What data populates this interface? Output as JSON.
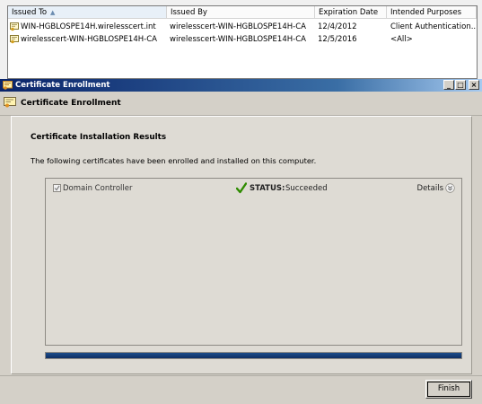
{
  "cert_list": {
    "columns": [
      "Issued To",
      "Issued By",
      "Expiration Date",
      "Intended Purposes"
    ],
    "sorted_column": "Issued To",
    "rows": [
      {
        "issued_to": "WIN-HGBLOSPE14H.wirelesscert.int",
        "issued_by": "wirelesscert-WIN-HGBLOSPE14H-CA",
        "expiration": "12/4/2012",
        "purposes": "Client Authentication..."
      },
      {
        "issued_to": "wirelesscert-WIN-HGBLOSPE14H-CA",
        "issued_by": "wirelesscert-WIN-HGBLOSPE14H-CA",
        "expiration": "12/5/2016",
        "purposes": "<All>"
      }
    ]
  },
  "dialog": {
    "title": "Certificate Enrollment",
    "header": "Certificate Enrollment",
    "section_title": "Certificate Installation Results",
    "description": "The following certificates have been enrolled and installed on this computer.",
    "window_buttons": {
      "minimize": "_",
      "maximize": "□",
      "close": "×"
    },
    "results": [
      {
        "name": "Domain Controller",
        "checked": true,
        "status_label": "STATUS:",
        "status_value": "Succeeded",
        "details_label": "Details"
      }
    ],
    "progress_fraction": 1.0,
    "finish_label": "Finish"
  },
  "colors": {
    "title_gradient_start": "#0a246a",
    "success_check": "#2e8b00",
    "progress": "#0e2f63"
  },
  "icons": [
    "certificate-icon",
    "checkmark-icon",
    "details-expand-icon",
    "sort-asc-icon"
  ]
}
